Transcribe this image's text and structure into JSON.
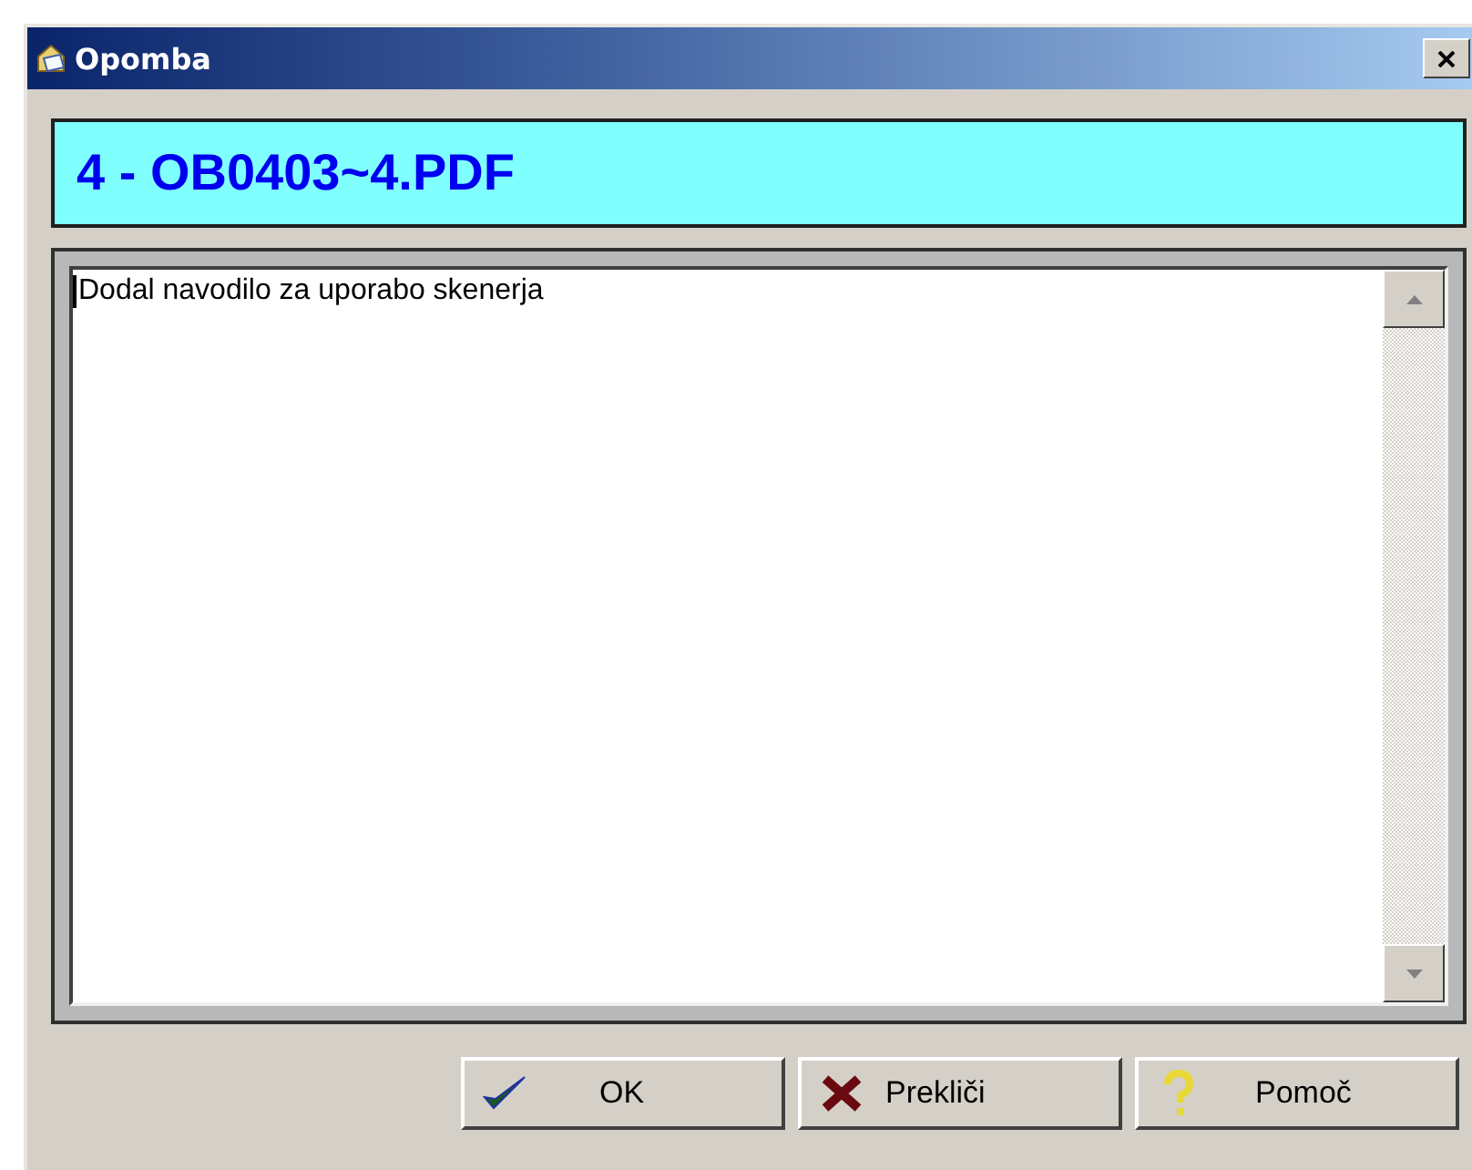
{
  "window": {
    "title": "Opomba"
  },
  "header": {
    "text": "4 - OB0403~4.PDF"
  },
  "note": {
    "value": "Dodal navodilo za uporabo skenerja"
  },
  "buttons": [
    {
      "kind": "ok",
      "label": "OK"
    },
    {
      "kind": "cancel",
      "label": "Prekliči"
    },
    {
      "kind": "help",
      "label": "Pomoč"
    }
  ]
}
